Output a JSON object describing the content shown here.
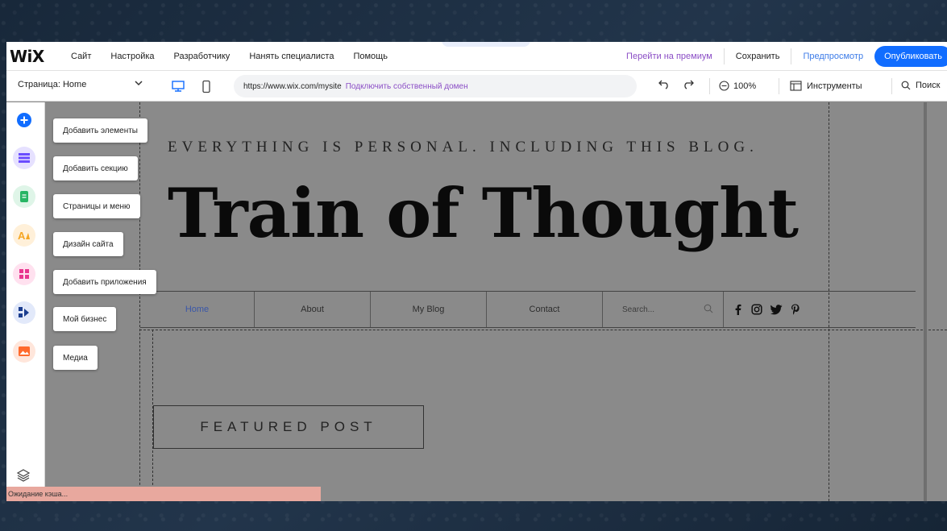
{
  "topbar": {
    "logo": "WiX",
    "menu": [
      {
        "label": "Сайт"
      },
      {
        "label": "Настройка"
      },
      {
        "label": "Разработчику"
      },
      {
        "label": "Нанять специалиста"
      },
      {
        "label": "Помощь"
      }
    ],
    "premium_label": "Перейти на премиум",
    "save_label": "Сохранить",
    "preview_label": "Предпросмотр",
    "publish_label": "Опубликовать"
  },
  "secondbar": {
    "page_label": "Страница: Home",
    "url": "https://www.wix.com/mysite",
    "connect_domain": "Подключить собственный домен",
    "zoom": "100%",
    "tools_label": "Инструменты",
    "search_label": "Поиск"
  },
  "leftrail": {
    "items": [
      {
        "label": "Добавить элементы",
        "icon": "plus-icon",
        "color": "#116dff"
      },
      {
        "label": "Добавить секцию",
        "icon": "section-icon",
        "color": "#6a4cff"
      },
      {
        "label": "Страницы и меню",
        "icon": "pages-icon",
        "color": "#27b564"
      },
      {
        "label": "Дизайн сайта",
        "icon": "design-icon",
        "color": "#f5a623"
      },
      {
        "label": "Добавить приложения",
        "icon": "apps-icon",
        "color": "#e8368f"
      },
      {
        "label": "Мой бизнес",
        "icon": "business-icon",
        "color": "#1b3d8f"
      },
      {
        "label": "Медиа",
        "icon": "media-icon",
        "color": "#ff6a2c"
      }
    ]
  },
  "site": {
    "tagline": "EVERYTHING IS PERSONAL. INCLUDING THIS BLOG.",
    "title": "Train of Thought",
    "nav": [
      {
        "label": "Home",
        "active": true
      },
      {
        "label": "About",
        "active": false
      },
      {
        "label": "My Blog",
        "active": false
      },
      {
        "label": "Contact",
        "active": false
      }
    ],
    "search_placeholder": "Search...",
    "social": [
      "facebook-icon",
      "instagram-icon",
      "twitter-icon",
      "pinterest-icon"
    ],
    "featured_label": "FEATURED POST"
  },
  "status": {
    "text": "Ожидание кэша..."
  }
}
